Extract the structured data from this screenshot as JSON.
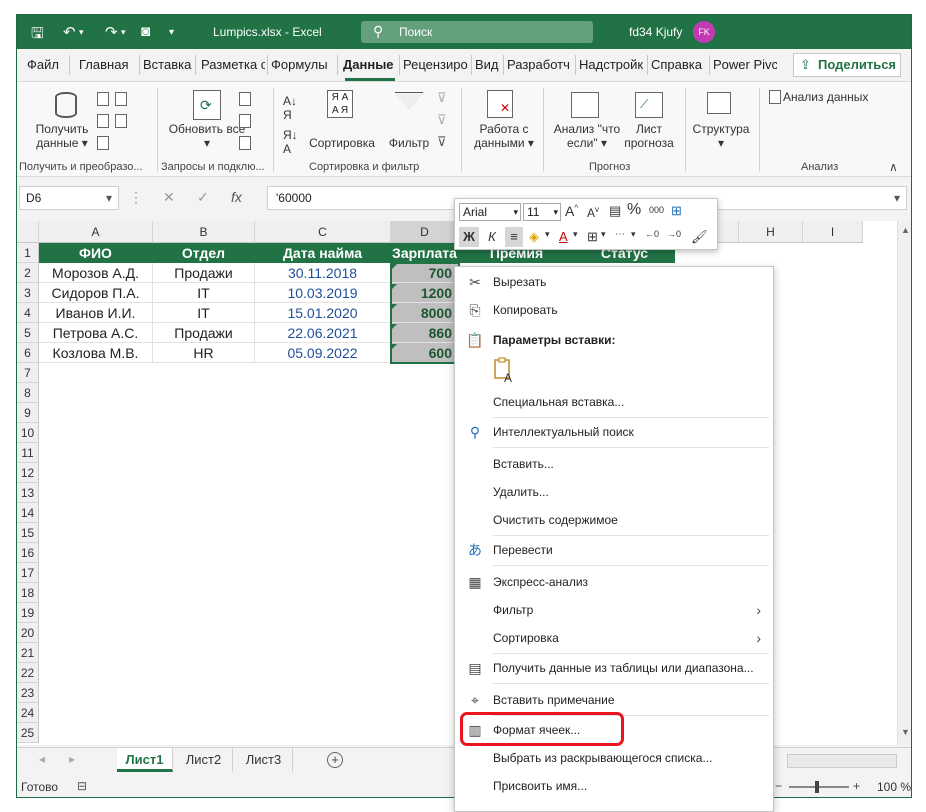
{
  "window": {
    "file_title": "Lumpics.xlsx  -  Excel",
    "search_placeholder": "Поиск",
    "user_name": "fd34 Kjufy",
    "avatar_initials": "FK",
    "accent_color": "#217346"
  },
  "ribbon_tabs": [
    "Файл",
    "Главная",
    "Вставка",
    "Разметка с",
    "Формулы",
    "Данные",
    "Рецензиро",
    "Вид",
    "Разработч",
    "Надстройк",
    "Справка",
    "Power Pivc"
  ],
  "active_tab": "Данные",
  "share_label": "Поделиться",
  "ribbon": {
    "get_data_label": "Получить данные",
    "refresh_all_label": "Обновить все",
    "sort_label": "Сортировка",
    "filter_label": "Фильтр",
    "data_tools_label": "Работа с данными",
    "whatif_label": "Анализ \"что если\"",
    "forecast_sheet_label": "Лист прогноза",
    "outline_label": "Структура",
    "data_analysis_label": "Анализ данных",
    "groups": {
      "get_transform": "Получить и преобразо...",
      "queries": "Запросы и подклю...",
      "sort_filter": "Сортировка и фильтр",
      "forecast": "Прогноз",
      "analysis": "Анализ"
    }
  },
  "formula_bar": {
    "name_box": "D6",
    "formula_value": "'60000"
  },
  "columns": [
    "A",
    "B",
    "C",
    "D",
    "E",
    "F",
    "G",
    "H",
    "I"
  ],
  "rows": [
    "1",
    "2",
    "3",
    "4",
    "5",
    "6",
    "7",
    "8",
    "9",
    "10",
    "11",
    "12",
    "13",
    "14",
    "15",
    "16",
    "17",
    "18",
    "19",
    "20",
    "21",
    "22",
    "23",
    "24",
    "25"
  ],
  "table": {
    "headers": [
      "ФИО",
      "Отдел",
      "Дата найма",
      "Зарплата",
      "Премия",
      "Статус"
    ],
    "rows": [
      [
        "Морозов А.Д.",
        "Продажи",
        "30.11.2018",
        "700"
      ],
      [
        "Сидоров П.А.",
        "IT",
        "10.03.2019",
        "1200"
      ],
      [
        "Иванов И.И.",
        "IT",
        "15.01.2020",
        "8000"
      ],
      [
        "Петрова А.С.",
        "Продажи",
        "22.06.2021",
        "860"
      ],
      [
        "Козлова М.В.",
        "HR",
        "05.09.2022",
        "600"
      ]
    ]
  },
  "mini_toolbar": {
    "font": "Arial",
    "size": "11",
    "bold": "Ж",
    "italic": "К",
    "grow_font": "A",
    "shrink_font": "A",
    "percent": "%",
    "thousands": "000"
  },
  "context_menu": {
    "cut": "Вырезать",
    "copy": "Копировать",
    "paste_options": "Параметры вставки:",
    "paste_special": "Специальная вставка...",
    "smart_lookup": "Интеллектуальный поиск",
    "insert": "Вставить...",
    "delete": "Удалить...",
    "clear_contents": "Очистить содержимое",
    "translate": "Перевести",
    "quick_analysis": "Экспресс-анализ",
    "filter": "Фильтр",
    "sort": "Сортировка",
    "get_data_from_table": "Получить данные из таблицы или диапазона...",
    "insert_note": "Вставить примечание",
    "format_cells": "Формат ячеек...",
    "pick_from_list": "Выбрать из раскрывающегося списка...",
    "define_name": "Присвоить имя..."
  },
  "sheets": [
    "Лист1",
    "Лист2",
    "Лист3"
  ],
  "active_sheet": "Лист1",
  "status": {
    "ready": "Готово",
    "zoom": "100 %"
  }
}
